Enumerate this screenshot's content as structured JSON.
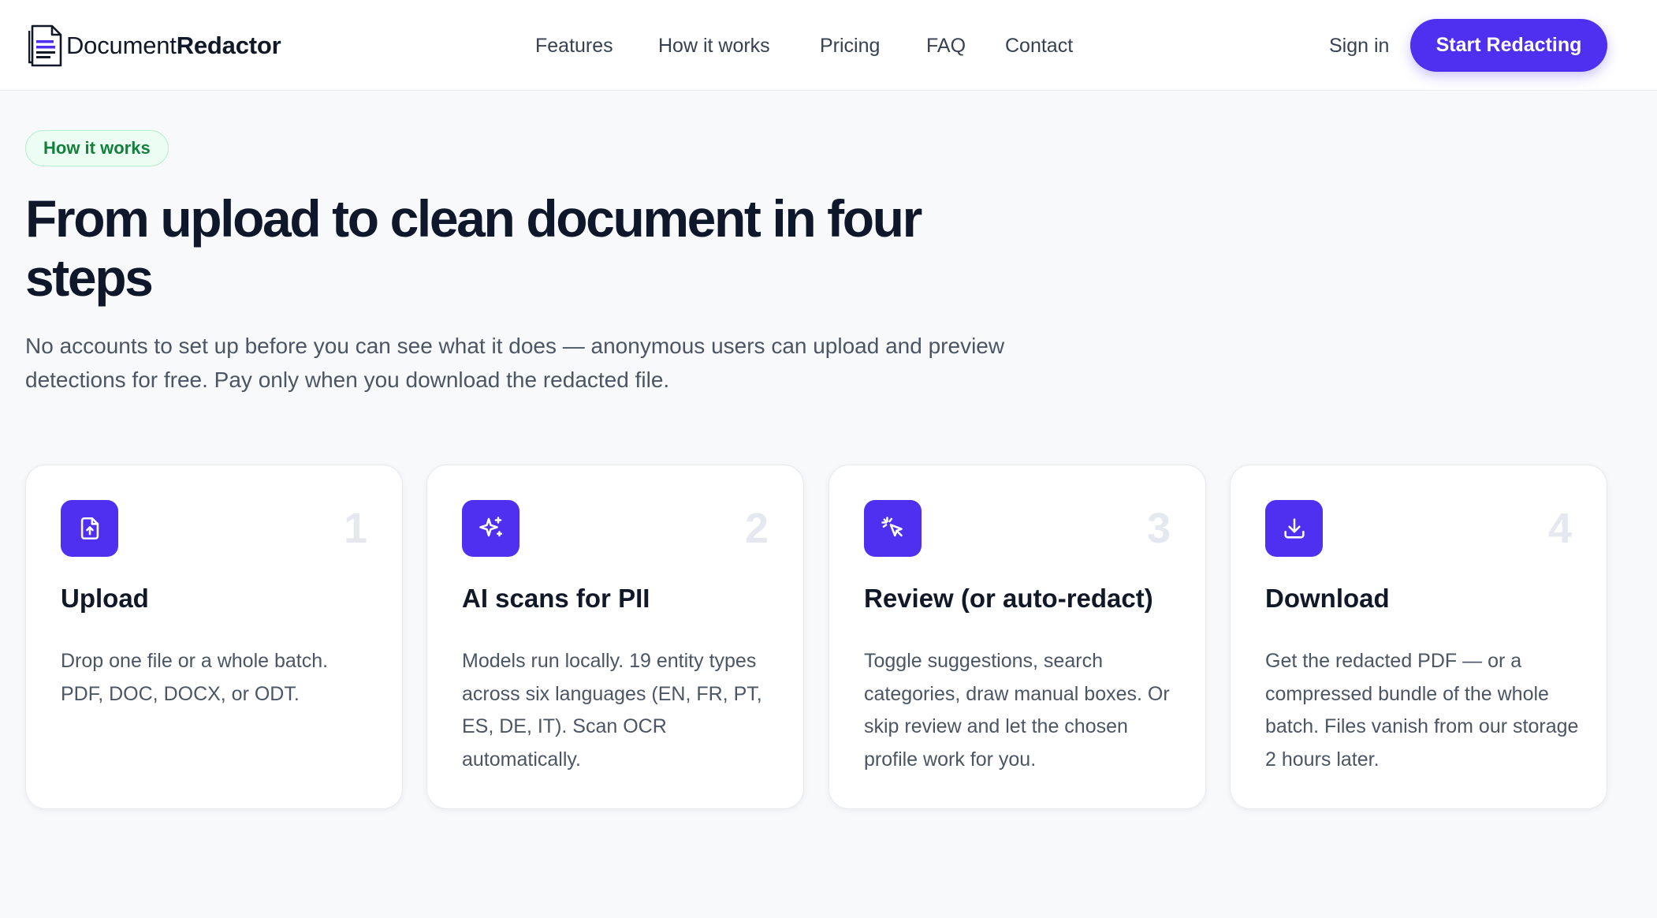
{
  "header": {
    "logo": {
      "text_light": "Document",
      "text_bold": "Redactor",
      "icon": "document-icon"
    },
    "nav": [
      "Features",
      "How it works",
      "Pricing",
      "FAQ",
      "Contact"
    ],
    "sign_in": "Sign in",
    "cta": "Start Redacting"
  },
  "hero": {
    "badge": "How it works",
    "title": "From upload to clean document in four steps",
    "subtitle": "No accounts to set up before you can see what it does — anonymous users can upload and preview detections for free. Pay only when you download the redacted file."
  },
  "steps": [
    {
      "number": "1",
      "icon": "file-upload-icon",
      "title": "Upload",
      "description": "Drop one file or a whole batch. PDF, DOC, DOCX, or ODT."
    },
    {
      "number": "2",
      "icon": "sparkles-icon",
      "title": "AI scans for PII",
      "description": "Models run locally. 19 entity types across six languages (EN, FR, PT, ES, DE, IT). Scan OCR automatically."
    },
    {
      "number": "3",
      "icon": "cursor-click-icon",
      "title": "Review (or auto-redact)",
      "description": "Toggle suggestions, search categories, draw manual boxes. Or skip review and let the chosen profile work for you."
    },
    {
      "number": "4",
      "icon": "download-icon",
      "title": "Download",
      "description": "Get the redacted PDF — or a compressed bundle of the whole batch. Files vanish from our storage 2 hours later."
    }
  ],
  "colors": {
    "accent": "#4f2ff0",
    "badge_bg": "#ecfdf3",
    "badge_text": "#15803d",
    "background": "#f8f9fb"
  }
}
